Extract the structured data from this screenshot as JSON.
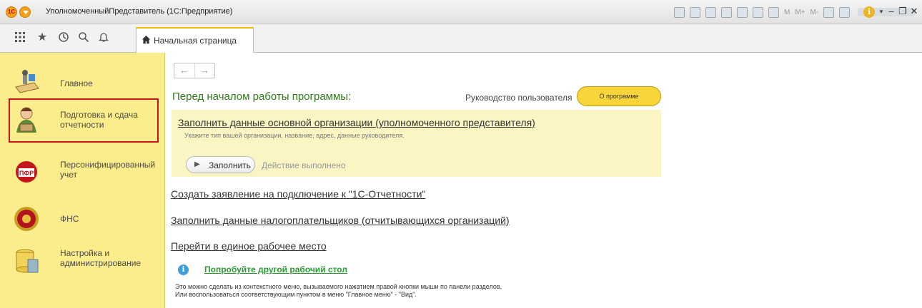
{
  "titlebar": {
    "logo_text": "1С",
    "title": "УполномоченныйПредставитель  (1С:Предприятие)",
    "tools": [
      "save-icon",
      "print-icon",
      "preview-icon",
      "upload-icon",
      "download-icon",
      "table-icon",
      "calendar-icon",
      "M",
      "M+",
      "M-",
      "zoom-icon",
      "panel-icon"
    ],
    "info_glyph": "i",
    "window_controls": [
      "▾",
      "–",
      "❐",
      "✕"
    ]
  },
  "toolbar": {
    "icons": [
      "apps-grid-icon",
      "star-icon",
      "history-icon",
      "search-icon",
      "bell-icon"
    ],
    "tab_label": "Начальная страница"
  },
  "sidebar": {
    "items": [
      {
        "label": "Главное",
        "icon": "desk-icon"
      },
      {
        "label": "Подготовка и сдача отчетности",
        "icon": "accountant-icon",
        "selected": true
      },
      {
        "label": "Персонифицированный учет",
        "icon": "pfr-icon"
      },
      {
        "label": "ФНС",
        "icon": "fns-emblem-icon"
      },
      {
        "label": "Настройка и администрирование",
        "icon": "database-icon"
      }
    ]
  },
  "main": {
    "back": "←",
    "forward": "→",
    "heading": "Перед началом работы программы:",
    "guide": "Руководство пользователя",
    "about_button": "О программе",
    "link_fill_org": "Заполнить данные основной организации (уполномоченного представителя)",
    "hint": "Укажите тип вашей организации, название, адрес, данные руководителя.",
    "fill_button": "Заполнить",
    "done_text": "Действие выполнено",
    "link_statement": "Создать заявление на подключение к \"1С-Отчетности\"",
    "link_taxpayers": "Заполнить данные налогоплательщиков (отчитывающихся организаций)",
    "link_workplace": "Перейти в единое рабочее место",
    "try_other": "Попробуйте другой рабочий стол",
    "note_line1": "Это можно сделать из контекстного меню, вызываемого нажатием правой кнопки мыши по панели разделов.",
    "note_line2": "Или воспользоваться соответствующим пунктом в меню \"Главное меню\" - \"Вид\"."
  },
  "colors": {
    "sidebar_bg": "#fbec8c",
    "selected_border": "#c7141a",
    "heading_green": "#2f7d1a",
    "accent_yellow": "#f8d53b",
    "highlight_bg": "#fbf5c4",
    "try_green": "#2c9a33",
    "info_blue": "#3da0d8"
  }
}
